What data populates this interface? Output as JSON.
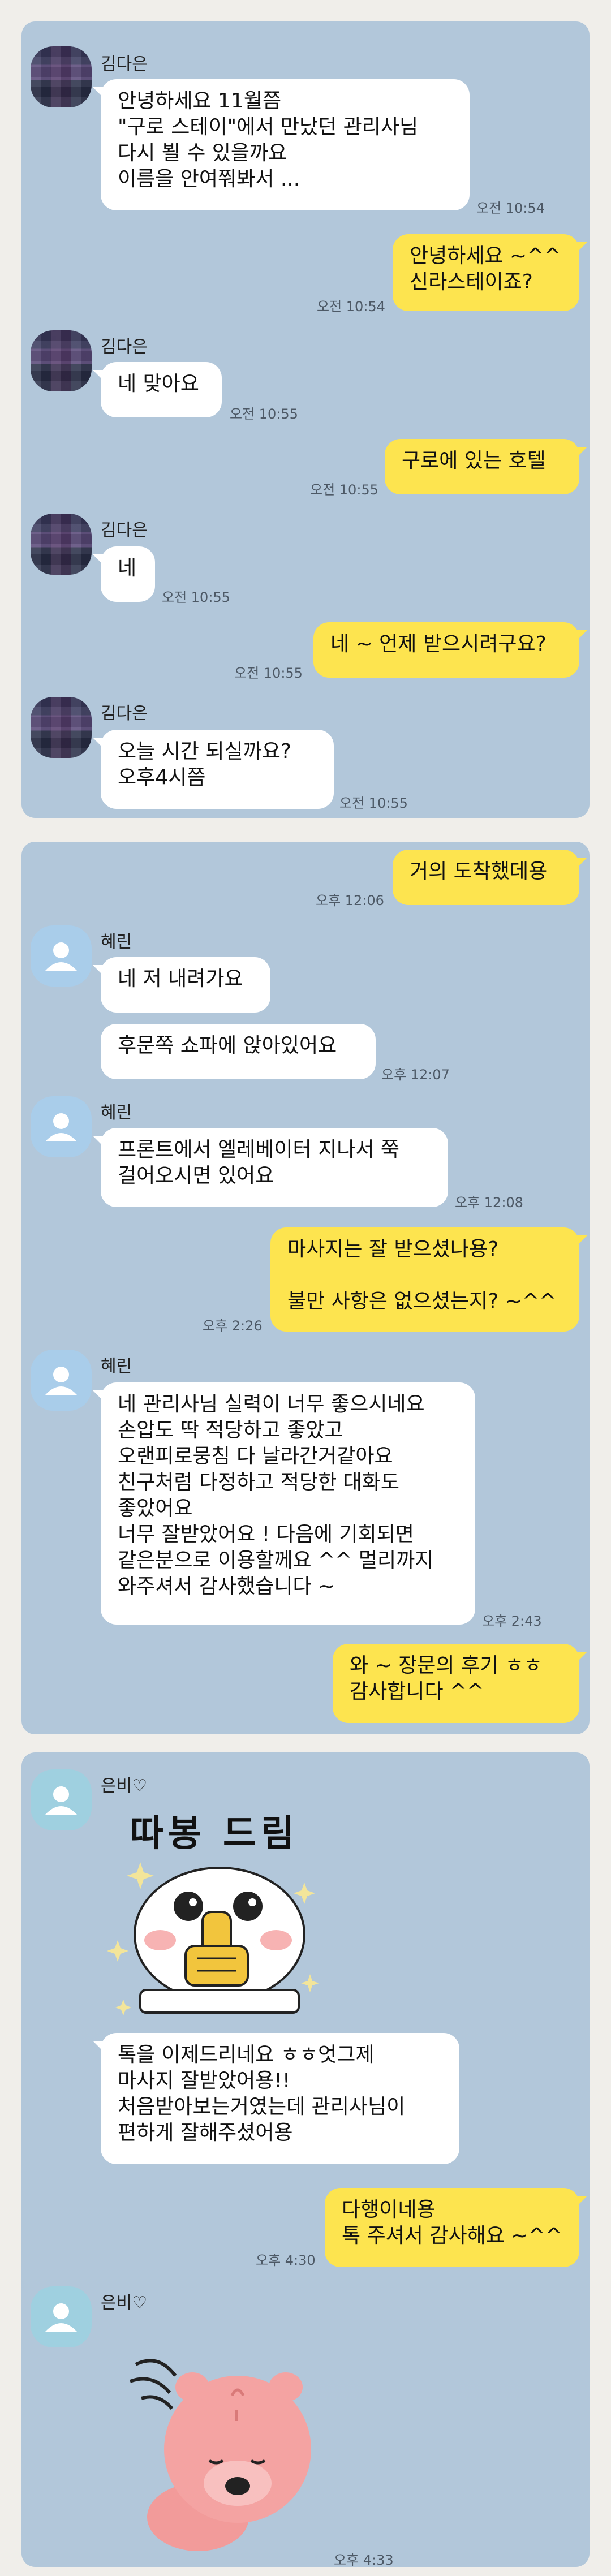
{
  "panel1": {
    "groups": [
      {
        "name": "김다은"
      },
      {
        "name": "김다은"
      },
      {
        "name": "김다은"
      },
      {
        "name": "김다은"
      }
    ],
    "messages": [
      {
        "text": "안녕하세요 11월쯤\n\"구로 스테이\"에서 만났던 관리사님\n다시 뵐 수 있을까요\n이름을 안여쭤봐서 ...",
        "time": "오전 10:54"
      },
      {
        "text": "안녕하세요 ~^^\n신라스테이죠?",
        "time": "오전 10:54"
      },
      {
        "text": "네 맞아요",
        "time": "오전 10:55"
      },
      {
        "text": "구로에 있는 호텔",
        "time": "오전 10:55"
      },
      {
        "text": "네",
        "time": "오전 10:55"
      },
      {
        "text": "네 ~ 언제 받으시려구요?",
        "time": "오전 10:55"
      },
      {
        "text": "오늘  시간 되실까요?\n오후4시쯤",
        "time": "오전 10:55"
      }
    ]
  },
  "panel2": {
    "groups": [
      {
        "name": "혜린"
      },
      {
        "name": "혜린"
      },
      {
        "name": "혜린"
      }
    ],
    "messages": [
      {
        "text": "거의 도착했데용",
        "time": "오후 12:06"
      },
      {
        "text": "네 저 내려가요",
        "time": ""
      },
      {
        "text": "후문쪽 쇼파에 앉아있어요",
        "time": "오후 12:07"
      },
      {
        "text": "프론트에서 엘레베이터 지나서 쭉\n걸어오시면 있어요",
        "time": "오후 12:08"
      },
      {
        "text": "마사지는 잘 받으셨나용?\n\n불만 사항은 없으셨는지? ~^^",
        "time": "오후 2:26"
      },
      {
        "text": "네 관리사님 실력이 너무 좋으시네요\n손압도 딱 적당하고 좋았고\n오랜피로뭉침 다 날라간거같아요\n친구처럼 다정하고 적당한 대화도\n좋았어요\n너무 잘받았어요 ! 다음에 기회되면\n같은분으로 이용할께요 ^^ 멀리까지\n와주셔서 감사했습니다 ~",
        "time": "오후 2:43"
      },
      {
        "text": "와 ~ 장문의 후기 ㅎㅎ\n감사합니다 ^^",
        "time": ""
      }
    ]
  },
  "panel3": {
    "groups": [
      {
        "name": "은비♡"
      },
      {
        "name": "은비♡"
      }
    ],
    "sticker1_title": "따봉 드림",
    "messages": [
      {
        "text": "톡을 이제드리네요 ㅎㅎ엇그제\n마사지 잘받았어용!!\n처음받아보는거였는데 관리사님이\n편하게 잘해주셨어용",
        "time": ""
      },
      {
        "text": "다행이네용\n톡 주셔서 감사해요 ~^^",
        "time": "오후 4:30"
      }
    ],
    "sticker2_time": "오후 4:33"
  },
  "colors": {
    "chat_bg": "#b2c7da",
    "outgoing": "#fde44f",
    "incoming": "#ffffff",
    "page_bg": "#f0eeea"
  }
}
